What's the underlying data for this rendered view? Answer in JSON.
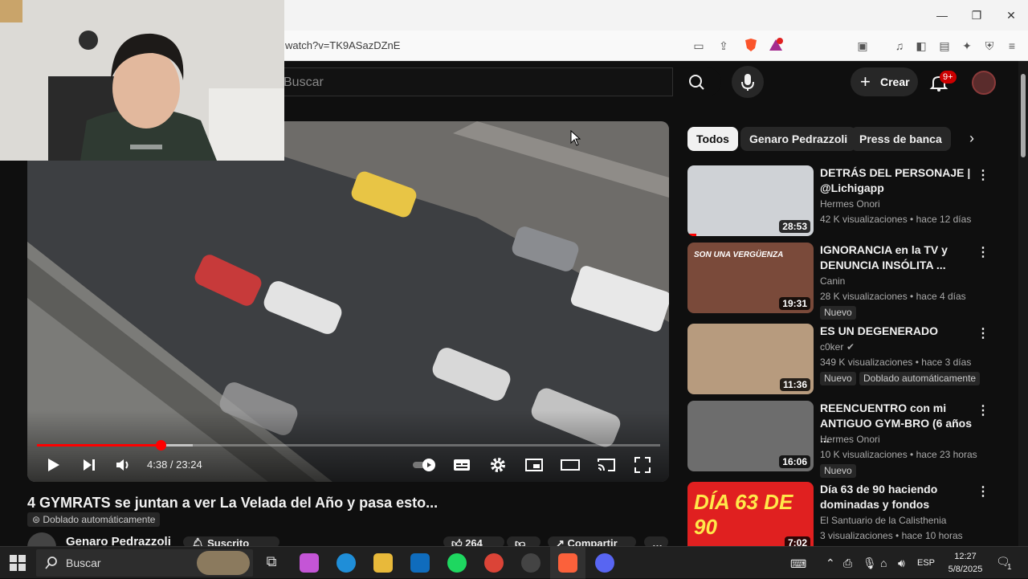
{
  "browser": {
    "url": "watch?v=TK9ASazDZnE",
    "window_controls": {
      "minimize": "—",
      "restore": "❐",
      "close": "✕"
    }
  },
  "youtube_header": {
    "search_placeholder": "Buscar",
    "create_label": "Crear",
    "notifications_count": "9+"
  },
  "player": {
    "current_time": "4:38 / 23:24",
    "progress_fraction": 0.198,
    "buffered_fraction": 0.25
  },
  "video": {
    "title": "4 GYMRATS se juntan a ver La Velada del Año y pasa esto...",
    "dubbed_label": "Doblado automáticamente",
    "channel": "Genaro Pedrazzoli",
    "subscribed_label": "Suscrito",
    "likes": "264",
    "share_label": "Compartir"
  },
  "chips": [
    "Todos",
    "Genaro Pedrazzoli",
    "Press de banca"
  ],
  "recommendations": [
    {
      "title_line1": "DETRÁS DEL PERSONAJE |",
      "title_line2": "@Lichigapp",
      "channel": "Hermes Onori",
      "meta": "42 K visualizaciones • hace 12 días",
      "duration": "28:53",
      "badges": [],
      "watched_fraction": 0.07,
      "thumb_color": "#cfd2d6"
    },
    {
      "title_line1": "IGNORANCIA en la TV y",
      "title_line2": "DENUNCIA INSÓLITA ...",
      "channel": "Canin",
      "meta": "28 K visualizaciones • hace 4 días",
      "duration": "19:31",
      "badges": [
        "Nuevo"
      ],
      "watched_fraction": 0.0,
      "thumb_color": "#7a4a3a",
      "thumb_caption": "SON UNA VERGÜENZA"
    },
    {
      "title_line1": "ES UN DEGENERADO",
      "title_line2": "",
      "channel": "c0ker",
      "meta": "349 K visualizaciones • hace 3 días",
      "duration": "11:36",
      "badges": [
        "Nuevo",
        "Doblado automáticamente"
      ],
      "watched_fraction": 0.0,
      "thumb_color": "#b79b7e"
    },
    {
      "title_line1": "REENCUENTRO con mi",
      "title_line2": "ANTIGUO GYM-BRO (6 años ...",
      "channel": "Hermes Onori",
      "meta": "10 K visualizaciones • hace 23 horas",
      "duration": "16:06",
      "badges": [
        "Nuevo"
      ],
      "watched_fraction": 0.0,
      "thumb_color": "#6d6d6d"
    },
    {
      "title_line1": "Día 63 de 90 haciendo",
      "title_line2": "dominadas y fondos",
      "channel": "El Santuario de la Calisthenia",
      "meta": "3 visualizaciones • hace 10 horas",
      "duration": "7:02",
      "badges": [],
      "watched_fraction": 0.0,
      "thumb_color": "#e02020",
      "thumb_caption": "DÍA 63 DE 90"
    }
  ],
  "taskbar": {
    "search_placeholder": "Buscar",
    "language": "ESP",
    "time": "12:27",
    "date": "5/8/2025",
    "notification_count": "1"
  },
  "colors": {
    "accent": "#ff0000",
    "background": "#0f0f0f",
    "chip_bg": "#272727"
  }
}
